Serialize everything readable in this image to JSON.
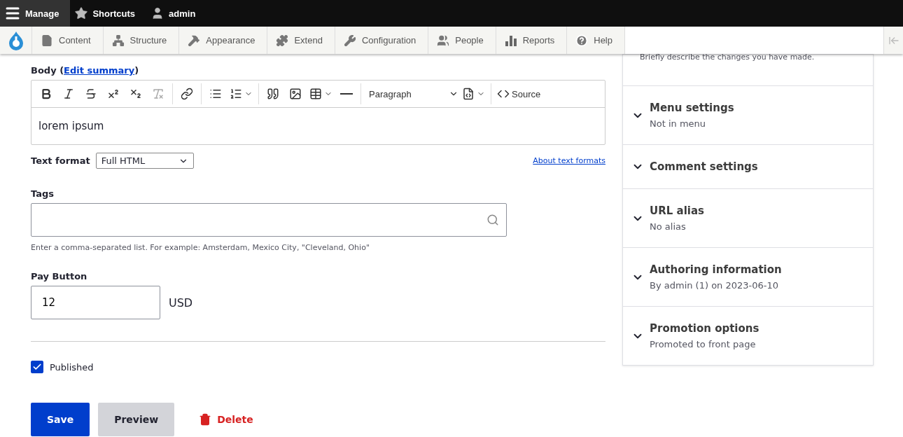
{
  "top_bar": {
    "items": [
      {
        "label": "Manage",
        "selected": true
      },
      {
        "label": "Shortcuts",
        "selected": false
      },
      {
        "label": "admin",
        "selected": false
      }
    ]
  },
  "nav": {
    "items": [
      {
        "label": "Content"
      },
      {
        "label": "Structure"
      },
      {
        "label": "Appearance"
      },
      {
        "label": "Extend"
      },
      {
        "label": "Configuration"
      },
      {
        "label": "People"
      },
      {
        "label": "Reports"
      },
      {
        "label": "Help"
      }
    ]
  },
  "body": {
    "label": "Body (",
    "link": "Edit summary",
    "label_end": ")",
    "value": "lorem ipsum",
    "tools": [
      {
        "kind": "bold",
        "disabled": false
      },
      {
        "kind": "italic",
        "disabled": false
      },
      {
        "kind": "strike",
        "disabled": false
      },
      {
        "kind": "sup",
        "disabled": false
      },
      {
        "kind": "sub",
        "disabled": false
      },
      {
        "kind": "clear",
        "disabled": true
      },
      {
        "kind": "divider"
      },
      {
        "kind": "link",
        "disabled": false
      },
      {
        "kind": "divider"
      },
      {
        "kind": "bullets",
        "disabled": false
      },
      {
        "kind": "numbers",
        "disabled": false
      },
      {
        "kind": "divider"
      },
      {
        "kind": "quote",
        "disabled": false
      },
      {
        "kind": "image",
        "disabled": false
      },
      {
        "kind": "table",
        "disabled": false
      },
      {
        "kind": "rule",
        "disabled": false
      },
      {
        "kind": "divider"
      },
      {
        "kind": "heading",
        "label": "Paragraph"
      },
      {
        "kind": "insert",
        "disabled": false
      },
      {
        "kind": "divider"
      },
      {
        "kind": "source",
        "label": "Source"
      }
    ],
    "format_label": "Text format",
    "format_value": "Full HTML",
    "format_link": "About text formats"
  },
  "tags": {
    "label": "Tags",
    "hint": "Enter a comma-separated list. For example: Amsterdam, Mexico City, \"Cleveland, Ohio\""
  },
  "pay": {
    "label": "Pay Button",
    "value": "12",
    "currency": "USD"
  },
  "published": {
    "label": "Published",
    "checked": true
  },
  "actions": [
    {
      "kind": "primary",
      "label": "Save"
    },
    {
      "kind": "secondary",
      "label": "Preview"
    },
    {
      "kind": "danger",
      "label": "Delete"
    }
  ],
  "sidebar": {
    "note": "Briefly describe the changes you have made.",
    "sections": [
      {
        "title": "Menu settings",
        "summary": "Not in menu",
        "expanded": false
      },
      {
        "title": "Comment settings",
        "expanded": false
      },
      {
        "title": "URL alias",
        "summary": "No alias",
        "expanded": false
      },
      {
        "title": "Authoring information",
        "summary": "By admin (1) on 2023-06-10",
        "expanded": false
      },
      {
        "title": "Promotion options",
        "summary": "Promoted to front page",
        "expanded": false
      }
    ]
  }
}
